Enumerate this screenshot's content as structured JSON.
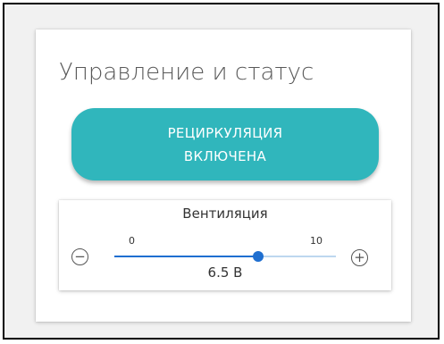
{
  "panel": {
    "title": "Управление и статус"
  },
  "recirculation": {
    "label": "РЕЦИРКУЛЯЦИЯ\nВКЛЮЧЕНА",
    "color": "#30b6bc"
  },
  "ventilation": {
    "title": "Вентиляция",
    "min_label": "0",
    "max_label": "10",
    "min": 0,
    "max": 10,
    "value": 6.5,
    "value_label": "6.5 В",
    "decrease_icon": "minus-circle-icon",
    "increase_icon": "plus-circle-icon",
    "accent_color": "#1f6fd0",
    "track_color": "#bdd7ef"
  }
}
